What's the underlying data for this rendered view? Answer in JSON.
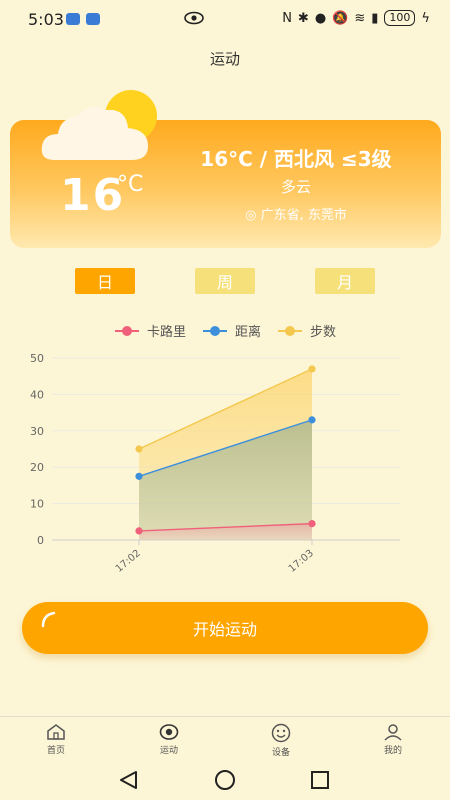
{
  "status": {
    "time": "5:03",
    "battery": "100"
  },
  "header": {
    "title": "运动"
  },
  "weather": {
    "temperature": "16",
    "unit": "°C",
    "summary": "16°C / 西北风 ≤3级",
    "condition": "多云",
    "location": "◎ 广东省, 东莞市",
    "icon": "partly-cloudy-icon"
  },
  "period_tabs": [
    {
      "label": "日",
      "active": true
    },
    {
      "label": "周",
      "active": false
    },
    {
      "label": "月",
      "active": false
    }
  ],
  "chart_data": {
    "type": "area",
    "x": [
      "17:02",
      "17:03"
    ],
    "ylim": [
      0,
      50
    ],
    "yticks": [
      0,
      10,
      20,
      30,
      40,
      50
    ],
    "grid": true,
    "legend_position": "top",
    "series": [
      {
        "name": "卡路里",
        "color": "#f0607a",
        "values": [
          2.5,
          4.5
        ]
      },
      {
        "name": "距离",
        "color": "#3d8fdc",
        "values": [
          17.5,
          33
        ]
      },
      {
        "name": "步数",
        "color": "#f4c84e",
        "values": [
          25,
          47
        ]
      }
    ]
  },
  "actions": {
    "start_label": "开始运动"
  },
  "tabbar": [
    {
      "label": "首页",
      "icon": "home-icon"
    },
    {
      "label": "运动",
      "icon": "sport-icon"
    },
    {
      "label": "设备",
      "icon": "device-icon"
    },
    {
      "label": "我的",
      "icon": "profile-icon"
    }
  ]
}
